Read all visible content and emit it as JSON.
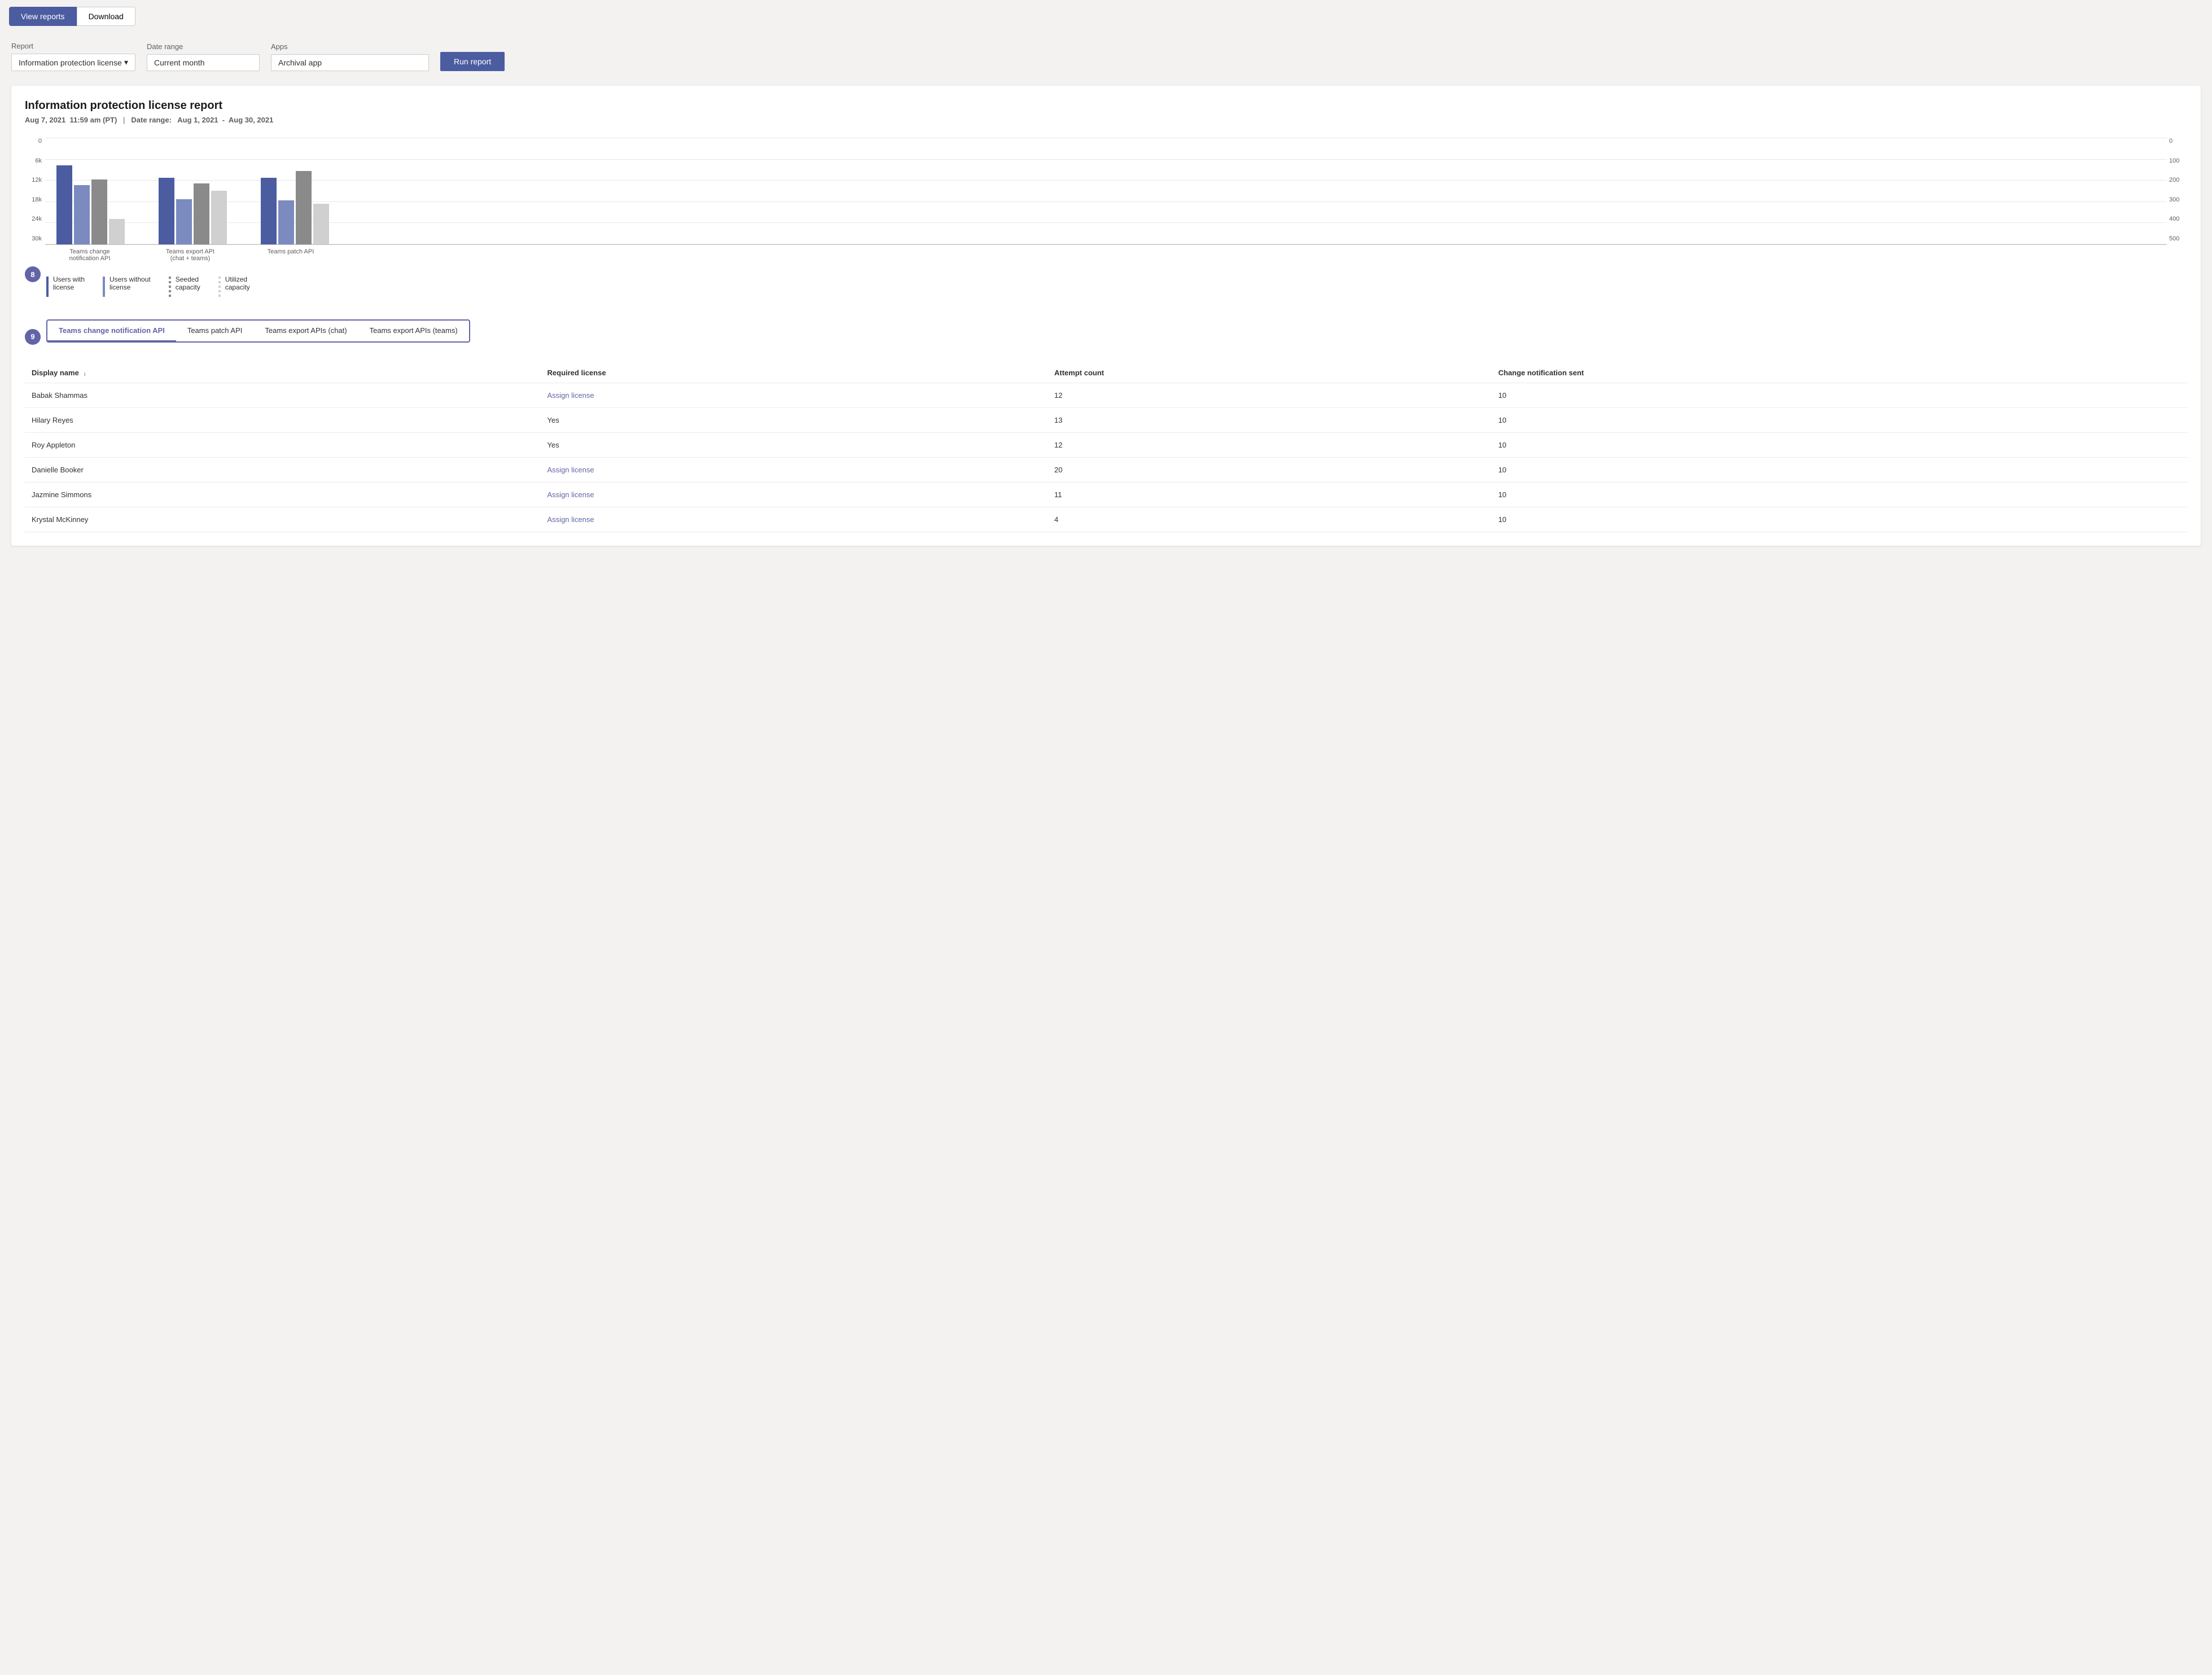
{
  "topBar": {
    "viewReportsLabel": "View reports",
    "downloadLabel": "Download"
  },
  "filters": {
    "reportLabel": "Report",
    "reportValue": "Information protection license",
    "dateRangeLabel": "Date range",
    "dateRangeValue": "Current month",
    "appsLabel": "Apps",
    "appsValue": "Archival app",
    "runReportLabel": "Run report"
  },
  "report": {
    "title": "Information protection license report",
    "dateGenerated": "Aug 7, 2021",
    "timeGenerated": "11:59 am (PT)",
    "dateRangeLabel": "Date range:",
    "dateRangeStart": "Aug 1, 2021",
    "dateRangeEnd": "Aug 30, 2021",
    "chart": {
      "yLeftLabels": [
        "0",
        "6k",
        "12k",
        "18k",
        "24k",
        "30k"
      ],
      "yRightLabels": [
        "0",
        "100",
        "200",
        "300",
        "400",
        "500"
      ],
      "groups": [
        {
          "label": "Teams change notification API",
          "bars": [
            {
              "color": "dark-blue",
              "height": 140
            },
            {
              "color": "mid-blue",
              "height": 105
            },
            {
              "color": "dark-gray",
              "height": 115
            },
            {
              "color": "light-gray",
              "height": 45
            }
          ]
        },
        {
          "label": "Teams export API\n(chat + teams)",
          "bars": [
            {
              "color": "dark-blue",
              "height": 118
            },
            {
              "color": "mid-blue",
              "height": 80
            },
            {
              "color": "dark-gray",
              "height": 108
            },
            {
              "color": "light-gray",
              "height": 95
            }
          ]
        },
        {
          "label": "Teams patch API",
          "bars": [
            {
              "color": "dark-blue",
              "height": 118
            },
            {
              "color": "mid-blue",
              "height": 78
            },
            {
              "color": "dark-gray",
              "height": 130
            },
            {
              "color": "light-gray",
              "height": 72
            }
          ]
        }
      ]
    },
    "legend": [
      {
        "label": "Users with\nlicense",
        "colorClass": "legend-line-dark"
      },
      {
        "label": "Users without\nlicense",
        "colorClass": "legend-line-mid"
      },
      {
        "label": "Seeded\ncapacity",
        "colorClass": "legend-line-dashed"
      },
      {
        "label": "Utilized\ncapacity",
        "colorClass": "legend-line-light"
      }
    ],
    "stepBadge8": "8",
    "stepBadge9": "9",
    "tabs": [
      {
        "label": "Teams change notification API",
        "active": true
      },
      {
        "label": "Teams patch API",
        "active": false
      },
      {
        "label": "Teams export APIs (chat)",
        "active": false
      },
      {
        "label": "Teams export APIs (teams)",
        "active": false
      }
    ],
    "tableColumns": [
      {
        "label": "Display name",
        "sortable": true
      },
      {
        "label": "Required license",
        "sortable": false
      },
      {
        "label": "Attempt count",
        "sortable": false
      },
      {
        "label": "Change notification sent",
        "sortable": false
      }
    ],
    "tableRows": [
      {
        "displayName": "Babak Shammas",
        "requiredLicense": "Assign license",
        "isLink": true,
        "attemptCount": "12",
        "notificationSent": "10"
      },
      {
        "displayName": "Hilary Reyes",
        "requiredLicense": "Yes",
        "isLink": false,
        "attemptCount": "13",
        "notificationSent": "10"
      },
      {
        "displayName": "Roy Appleton",
        "requiredLicense": "Yes",
        "isLink": false,
        "attemptCount": "12",
        "notificationSent": "10"
      },
      {
        "displayName": "Danielle Booker",
        "requiredLicense": "Assign license",
        "isLink": true,
        "attemptCount": "20",
        "notificationSent": "10"
      },
      {
        "displayName": "Jazmine Simmons",
        "requiredLicense": "Assign license",
        "isLink": true,
        "attemptCount": "11",
        "notificationSent": "10"
      },
      {
        "displayName": "Krystal McKinney",
        "requiredLicense": "Assign license",
        "isLink": true,
        "attemptCount": "4",
        "notificationSent": "10"
      }
    ]
  }
}
